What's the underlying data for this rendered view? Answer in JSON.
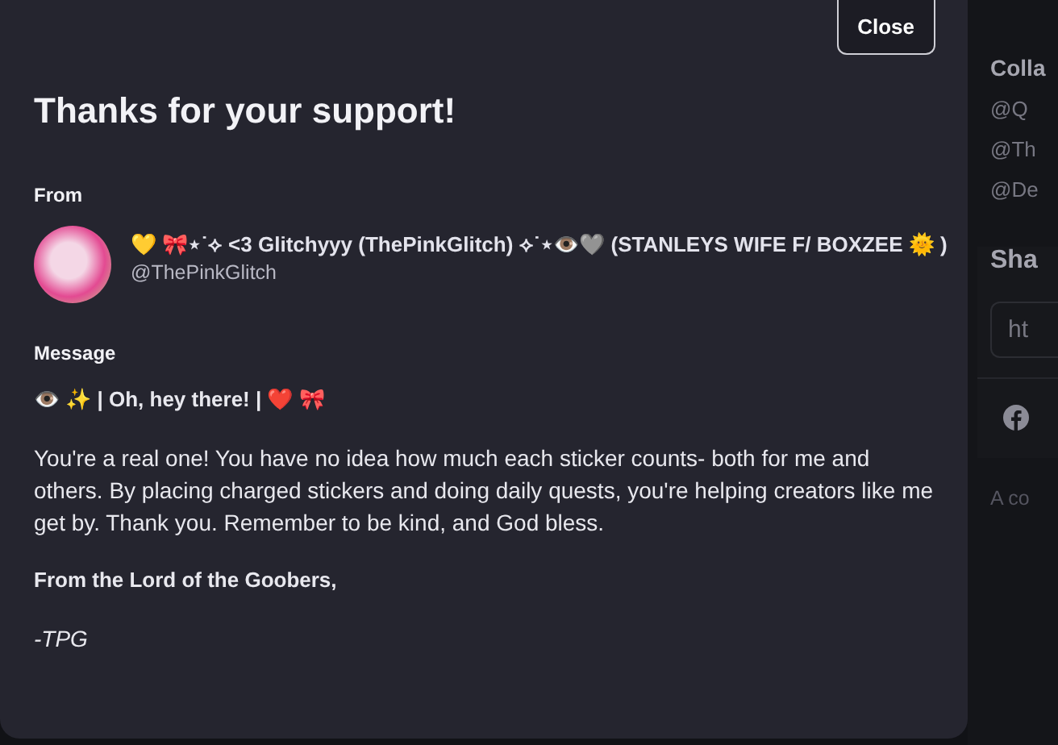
{
  "modal": {
    "title": "Thanks for your support!",
    "close_button": "Close",
    "from_label": "From",
    "sender": {
      "display_name": "💛 🎀⋆˙⟡ <3 Glitchyyy (ThePinkGlitch) ⟡˙⋆👁️🩶 (STANLEYS WIFE F/ BOXZEE 🌞 )",
      "handle": "@ThePinkGlitch"
    },
    "message_label": "Message",
    "message": [
      {
        "kind": "bold",
        "text": "👁️ ✨ | Oh, hey there! | ❤️ 🎀"
      },
      {
        "kind": "plain",
        "text": "You're a real one! You have no idea how much each sticker counts- both for me and others. By placing charged stickers and doing daily quests, you're helping creators like me get by. Thank you. Remember to be kind, and God bless."
      },
      {
        "kind": "bold",
        "text": "From the Lord of the Goobers,"
      },
      {
        "kind": "italic",
        "text": "-TPG"
      }
    ]
  },
  "side": {
    "collab_heading": "Colla",
    "collaborators": [
      "@Q",
      "@Th",
      "@De"
    ],
    "share_heading": "Sha",
    "share_link": "ht",
    "footer_text": "A co"
  }
}
